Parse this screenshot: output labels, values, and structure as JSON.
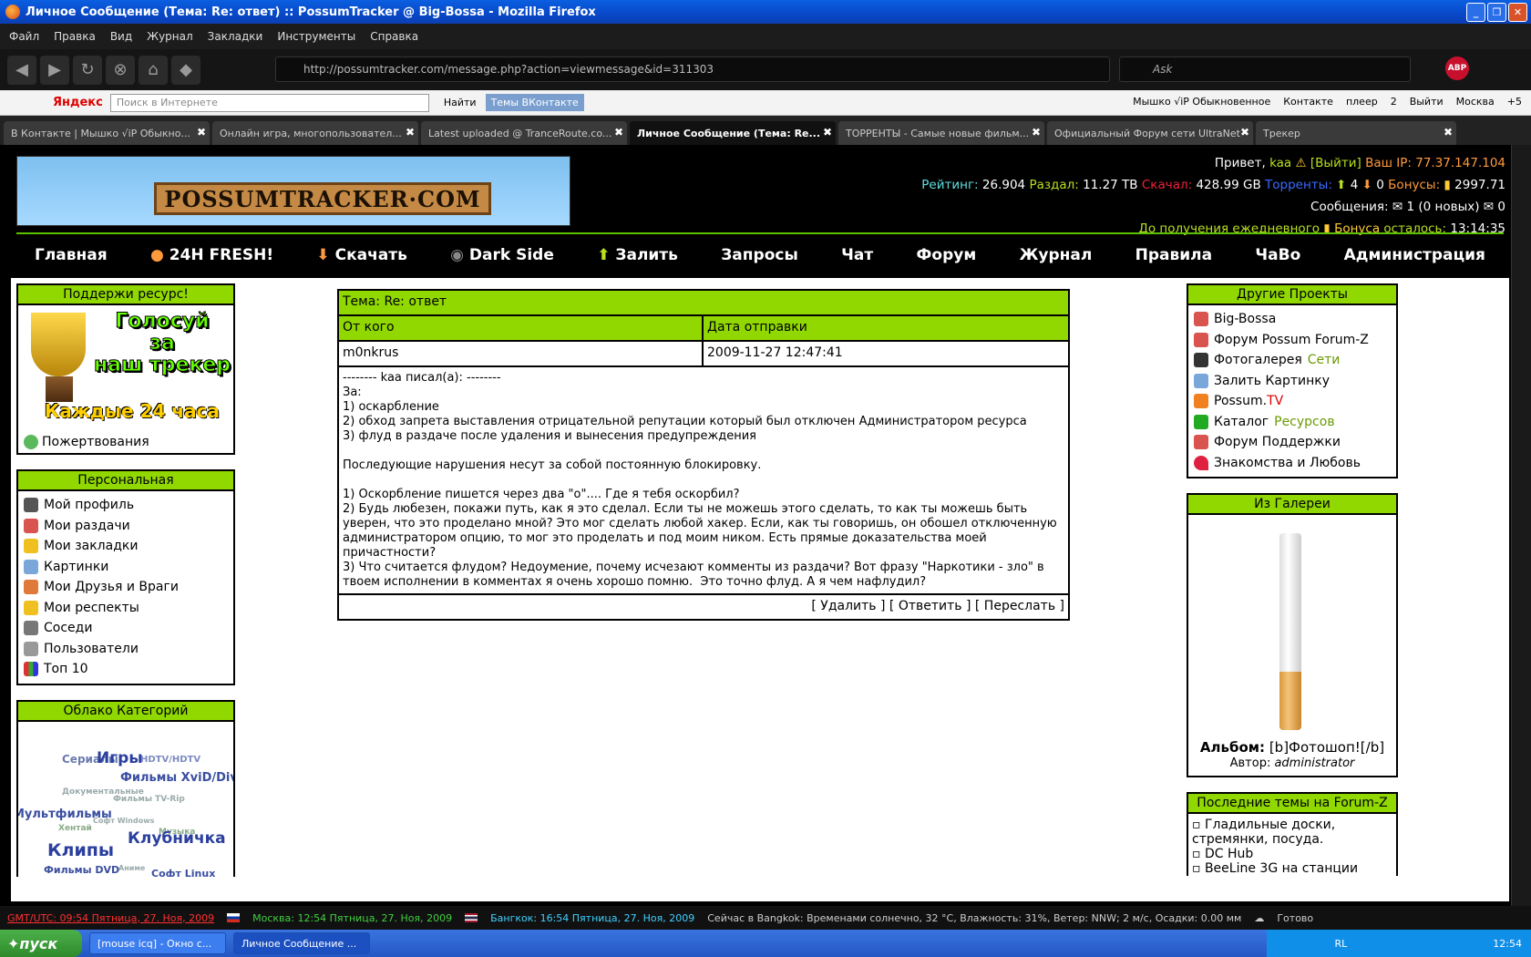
{
  "window": {
    "title": "Личное Сообщение (Тема: Re: ответ) :: PossumTracker @ Big-Bossa - Mozilla Firefox"
  },
  "menu": [
    "Файл",
    "Правка",
    "Вид",
    "Журнал",
    "Закладки",
    "Инструменты",
    "Справка"
  ],
  "nav": {
    "url": "http://possumtracker.com/message.php?action=viewmessage&id=311303",
    "search_placeholder": "Ask"
  },
  "yandex": {
    "logo": "Яндекс",
    "search_placeholder": "Поиск в Интернете",
    "find": "Найти",
    "vk_themes": "Темы ВКонтакте",
    "right": [
      "Мышко √iP Обыкновенное",
      "Контакте",
      "плеер",
      "2",
      "Выйти",
      "Москва",
      "+5"
    ]
  },
  "tabs": [
    {
      "label": "В Контакте | Мышко √iP Обыкно..."
    },
    {
      "label": "Онлайн игра, многопользовател..."
    },
    {
      "label": "Latest uploaded @ TranceRoute.co..."
    },
    {
      "label": "Личное Сообщение (Тема: Re..."
    },
    {
      "label": "ТОРРЕНТЫ - Самые новые фильм..."
    },
    {
      "label": "Официальный Форум сети UltraNet"
    },
    {
      "label": "Трекер"
    }
  ],
  "header": {
    "logo_text": "POSSUMTRACKER·COM",
    "greeting": "Привет,",
    "user": "kaa",
    "logout": "[Выйти]",
    "ip_label": "Ваш IP:",
    "ip": "77.37.147.104",
    "rating_label": "Рейтинг:",
    "rating": "26.904",
    "up_label": "Раздал:",
    "up": "11.27 TB",
    "down_label": "Скачал:",
    "down": "428.99 GB",
    "torrents_label": "Торренты:",
    "seeding": "4",
    "leeching": "0",
    "bonus_label": "Бонусы:",
    "bonus": "2997.71",
    "messages_label": "Сообщения:",
    "messages": "1 (0 новых)",
    "outbox": "0",
    "daily_pre": "До получения ежедневного",
    "daily_bonus": "Бонуса",
    "daily_post": "осталось:",
    "daily_time": "13:14:35"
  },
  "mainmenu": [
    "Главная",
    "24H FRESH!",
    "Скачать",
    "Dark Side",
    "Залить",
    "Запросы",
    "Чат",
    "Форум",
    "Журнал",
    "Правила",
    "ЧаВо",
    "Администрация"
  ],
  "support": {
    "title": "Поддержи ресурс!",
    "vote1": "Голосуй",
    "vote2": "за",
    "vote3": "наш трекер",
    "band": "Каждые 24 часа",
    "donate": "Пожертвования"
  },
  "personal": {
    "title": "Персональная",
    "items": [
      "Мой профиль",
      "Мои раздачи",
      "Мои закладки",
      "Картинки",
      "Мои Друзья и Враги",
      "Мои респекты",
      "Соседи",
      "Пользователи",
      "Топ 10"
    ]
  },
  "cloud": {
    "title": "Облако Категорий",
    "tags": [
      "Сериалы",
      "Игры",
      "HDTV/HDTV",
      "Фильмы XviD/DivX",
      "Документальные",
      "Фильмы TV-Rip",
      "Мультфильмы",
      "Софт Windows",
      "Хентай",
      "Музыка",
      "Клипы",
      "Клубничка",
      "Фильмы DVD",
      "Аниме",
      "Софт Linux"
    ]
  },
  "message": {
    "subject": "Тема: Re: ответ",
    "from_label": "От кого",
    "date_label": "Дата отправки",
    "from": "m0nkrus",
    "date": "2009-11-27 12:47:41",
    "body": "-------- kaa писал(а): --------\nЗа:\n1) оскарбление\n2) обход запрета выставления отрицательной репутации который был отключен Администратором ресурса\n3) флуд в раздаче после удаления и вынесения предупреждения\n\nПоследующие нарушения несут за собой постоянную блокировку.\n\n1) Оскорбление пишется через два \"о\".... Где я тебя оскорбил?\n2) Будь любезен, покажи путь, как я это сделал. Если ты не можешь этого сделать, то как ты можешь быть уверен, что это проделано мной? Это мог сделать любой хакер. Если, как ты говоришь, он обошел отключенную администратором опцию, то мог это проделать и под моим ником. Есть прямые доказательства моей причастности?\n3) Что считается флудом? Недоумение, почему исчезают комменты из раздачи? Вот фразу \"Наркотики - зло\" в твоем исполнении в комментах я очень хорошо помню.  Это точно флуд. А я чем нафлудил?",
    "delete": "[ Удалить ]",
    "reply": "[ Ответить ]",
    "forward": "[ Переслать ]"
  },
  "other": {
    "title": "Другие Проекты",
    "items": [
      {
        "a": "Big-Bossa",
        "b": ""
      },
      {
        "a": "Форум Possum Forum-Z",
        "b": ""
      },
      {
        "a": "Фотогалерея",
        "b": "Сети"
      },
      {
        "a": "Залить Картинку",
        "b": ""
      },
      {
        "a": "Possum.",
        "b": "TV"
      },
      {
        "a": "Каталог",
        "b": "Ресурсов"
      },
      {
        "a": "Форум Поддержки",
        "b": ""
      },
      {
        "a": "Знакомства и Любовь",
        "b": ""
      }
    ]
  },
  "gallery": {
    "title": "Из Галереи",
    "album_label": "Альбом:",
    "album": "[b]Фотошоп![/b]",
    "author_label": "Автор:",
    "author": "administrator"
  },
  "forum": {
    "title": "Последние темы на Forum-Z",
    "items": [
      "Гладильные доски, стремянки, посуда.",
      "DC Hub",
      "BeeLine 3G на станции"
    ]
  },
  "status": {
    "gmt": "GMT/UTC: 09:54 Пятница, 27. Ноя, 2009",
    "moscow": "Москва: 12:54 Пятница, 27. Ноя, 2009",
    "bangkok": "Бангкок: 16:54 Пятница, 27. Ноя, 2009",
    "weather": "Сейчас в Bangkok: Временами солнечно, 32 °C, Влажность: 31%, Ветер: NNW; 2 м/с, Осадки: 0.00 мм",
    "ready": "Готово"
  },
  "taskbar": {
    "start": "пуск",
    "task1": "[mouse icq] - Окно с...",
    "task2": "Личное Сообщение ...",
    "lang": "RL",
    "clock": "12:54"
  }
}
